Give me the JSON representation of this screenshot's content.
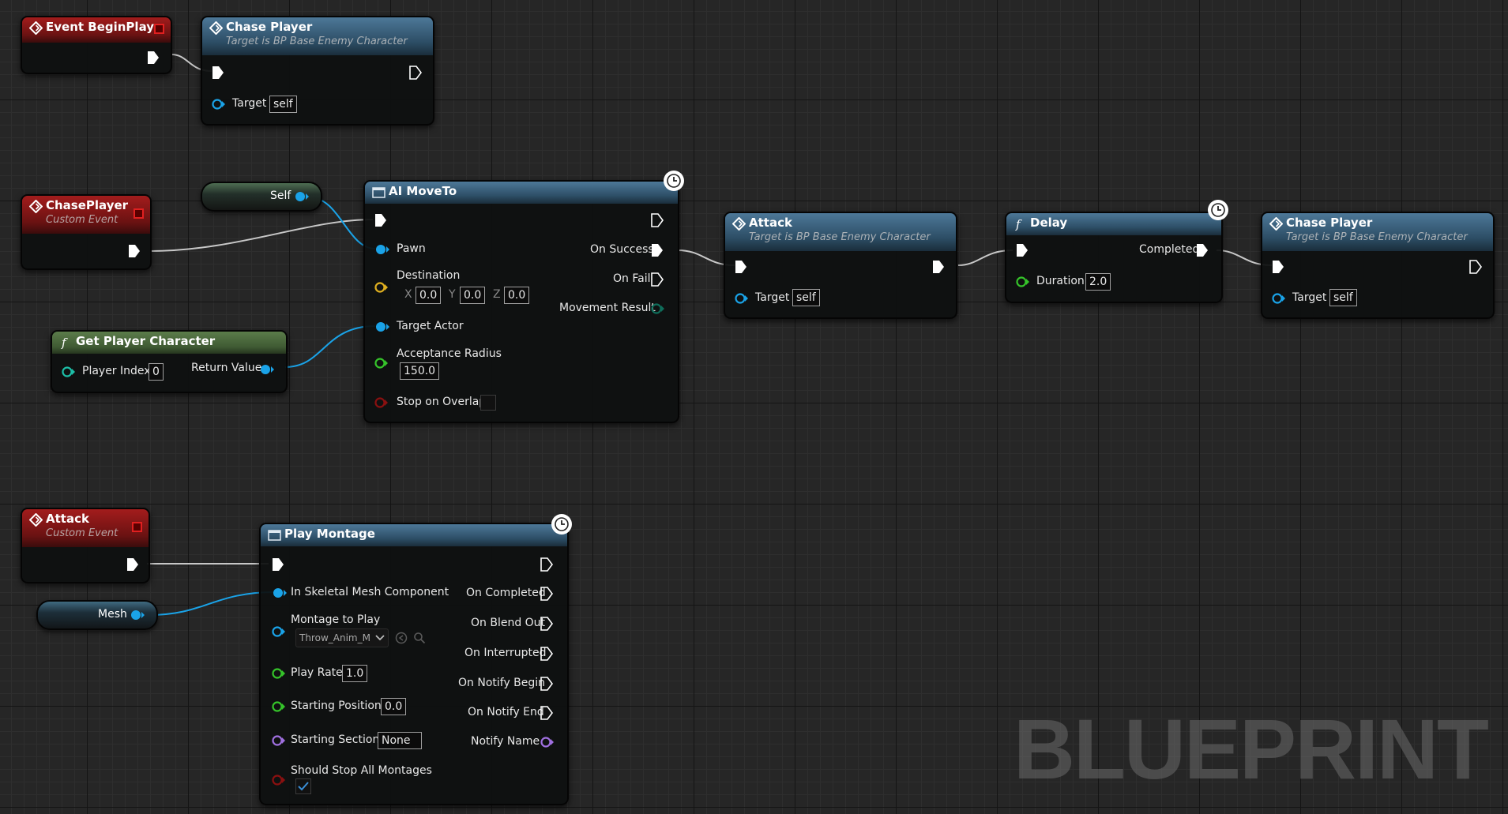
{
  "nodes": {
    "event_beginplay": {
      "title": "Event BeginPlay"
    },
    "chase_player_top": {
      "title": "Chase Player",
      "subtitle": "Target is BP Base Enemy Character",
      "target_label": "Target",
      "target_value": "self"
    },
    "chaseplayer_event": {
      "title": "ChasePlayer",
      "subtitle": "Custom Event"
    },
    "self_var": {
      "label": "Self"
    },
    "get_player_character": {
      "title": "Get Player Character",
      "player_index_label": "Player Index",
      "player_index_value": "0",
      "return_label": "Return Value"
    },
    "ai_moveto": {
      "title": "AI MoveTo",
      "pawn": "Pawn",
      "destination": "Destination",
      "x_label": "X",
      "x_value": "0.0",
      "y_label": "Y",
      "y_value": "0.0",
      "z_label": "Z",
      "z_value": "0.0",
      "target_actor": "Target Actor",
      "acceptance_radius": "Acceptance Radius",
      "acceptance_value": "150.0",
      "stop_on_overlap": "Stop on Overlap",
      "on_success": "On Success",
      "on_fail": "On Fail",
      "movement_result": "Movement Result"
    },
    "attack_call": {
      "title": "Attack",
      "subtitle": "Target is BP Base Enemy Character",
      "target_label": "Target",
      "target_value": "self"
    },
    "delay": {
      "title": "Delay",
      "completed": "Completed",
      "duration_label": "Duration",
      "duration_value": "2.0"
    },
    "chase_player_right": {
      "title": "Chase Player",
      "subtitle": "Target is BP Base Enemy Character",
      "target_label": "Target",
      "target_value": "self"
    },
    "attack_event": {
      "title": "Attack",
      "subtitle": "Custom Event"
    },
    "mesh_var": {
      "label": "Mesh"
    },
    "play_montage": {
      "title": "Play Montage",
      "in_skeletal": "In Skeletal Mesh Component",
      "montage_to_play": "Montage to Play",
      "montage_value": "Throw_Anim_M",
      "play_rate": "Play Rate",
      "play_rate_value": "1.0",
      "starting_position": "Starting Position",
      "starting_position_value": "0.0",
      "starting_section": "Starting Section",
      "starting_section_value": "None",
      "should_stop": "Should Stop All Montages",
      "should_stop_checked": true,
      "on_completed": "On Completed",
      "on_blend_out": "On Blend Out",
      "on_interrupted": "On Interrupted",
      "on_notify_begin": "On Notify Begin",
      "on_notify_end": "On Notify End",
      "notify_name": "Notify Name"
    }
  },
  "watermark": "BLUEPRINT",
  "colors": {
    "exec": "#ffffff",
    "object_pin": "#1aa3e8",
    "vector_pin": "#e0b020",
    "float_pin": "#35c42a",
    "bool_pin": "#8a1010",
    "name_pin": "#a070e0",
    "enum_pin": "#0f6d5a",
    "wire_exec": "#c8c8c8"
  }
}
